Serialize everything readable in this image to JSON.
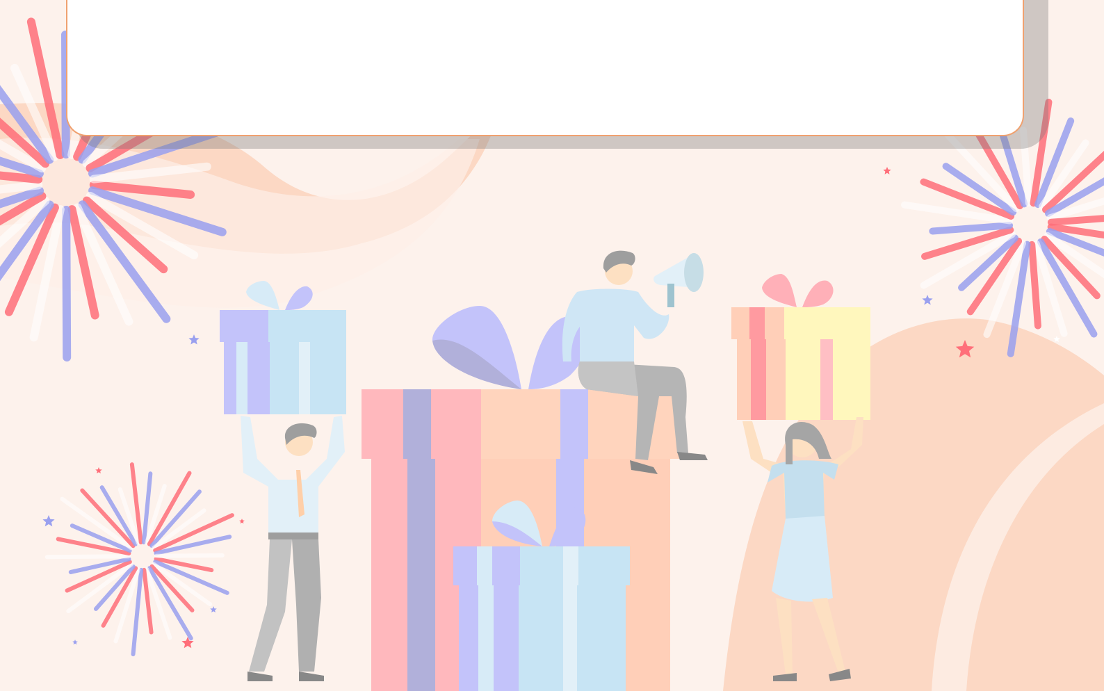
{
  "banner": {
    "message": ""
  },
  "colors": {
    "background": "#fdf2ec",
    "peach": "#fcdac7",
    "coral": "#ff6f7a",
    "periwinkle": "#9aa0ef",
    "light_blue": "#c7e4f4",
    "lavender": "#c3c3fa",
    "pink": "#ffb8bd",
    "yellow": "#fff7bd",
    "panel_border": "#f0a16f",
    "gray": "#b8b8b8"
  },
  "illustration": {
    "fireworks": [
      "firework-top-left",
      "firework-bottom-left",
      "firework-top-right"
    ],
    "figures": [
      "man-holding-blue-gift",
      "man-with-megaphone",
      "woman-holding-yellow-gift"
    ],
    "gifts": [
      "large-pink-gift",
      "small-blue-gift",
      "blue-gift",
      "yellow-gift"
    ]
  }
}
